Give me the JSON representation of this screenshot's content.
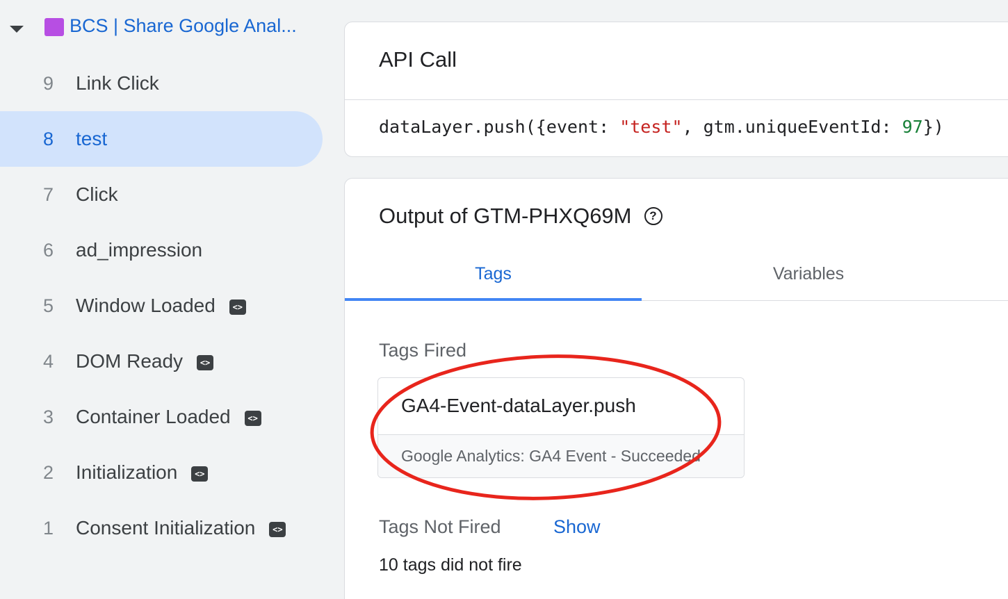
{
  "sidebar": {
    "container_name": "BCS | Share Google Anal...",
    "events": [
      {
        "num": "9",
        "label": "Link Click",
        "code_icon": false,
        "selected": false
      },
      {
        "num": "8",
        "label": "test",
        "code_icon": false,
        "selected": true
      },
      {
        "num": "7",
        "label": "Click",
        "code_icon": false,
        "selected": false
      },
      {
        "num": "6",
        "label": "ad_impression",
        "code_icon": false,
        "selected": false
      },
      {
        "num": "5",
        "label": "Window Loaded",
        "code_icon": true,
        "selected": false
      },
      {
        "num": "4",
        "label": "DOM Ready",
        "code_icon": true,
        "selected": false
      },
      {
        "num": "3",
        "label": "Container Loaded",
        "code_icon": true,
        "selected": false
      },
      {
        "num": "2",
        "label": "Initialization",
        "code_icon": true,
        "selected": false
      },
      {
        "num": "1",
        "label": "Consent Initialization",
        "code_icon": true,
        "selected": false
      }
    ]
  },
  "api_call": {
    "title": "API Call",
    "code_prefix": "dataLayer.push({event: ",
    "code_string": "\"test\"",
    "code_middle": ", gtm.uniqueEventId: ",
    "code_number": "97",
    "code_suffix": "})"
  },
  "output": {
    "title": "Output of GTM-PHXQ69M",
    "tabs": {
      "tags": "Tags",
      "variables": "Variables"
    },
    "tags_fired_label": "Tags Fired",
    "fired_tag": {
      "name": "GA4-Event-dataLayer.push",
      "status": "Google Analytics: GA4 Event - Succeeded"
    },
    "tags_not_fired_label": "Tags Not Fired",
    "show_label": "Show",
    "not_fired_count": "10 tags did not fire"
  },
  "colors": {
    "accent": "#1967d2",
    "selected_bg": "#d2e3fc",
    "annotation": "#e8251c",
    "container_swatch": "#b74ee3"
  }
}
